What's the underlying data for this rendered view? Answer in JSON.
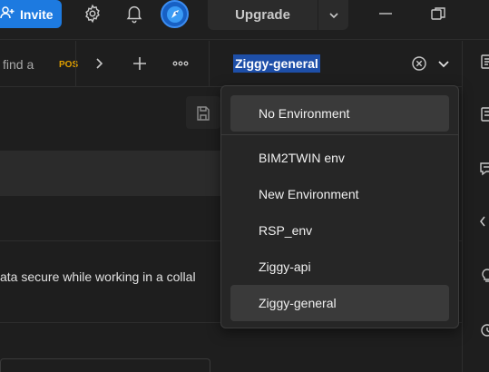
{
  "titlebar": {
    "invite_label": "Invite",
    "upgrade_label": "Upgrade",
    "icons": [
      "invite-icon",
      "settings-icon",
      "notifications-icon",
      "avatar",
      "chevron-down-icon",
      "minimize-icon",
      "restore-icon"
    ]
  },
  "tabs": {
    "search_text": "find a",
    "method_label": "POS"
  },
  "environment": {
    "selected": "Ziggy-general"
  },
  "dropdown": {
    "no_env_label": "No Environment",
    "items": [
      "BIM2TWIN env",
      "New Environment",
      "RSP_env",
      "Ziggy-api",
      "Ziggy-general"
    ],
    "highlighted": "Ziggy-general"
  },
  "content": {
    "body_text": "ata secure while working in a collal"
  },
  "colors": {
    "accent": "#1d7ae0",
    "selection": "#1e4fa8",
    "method_post": "#e0a000",
    "background": "#1e1e1e"
  }
}
